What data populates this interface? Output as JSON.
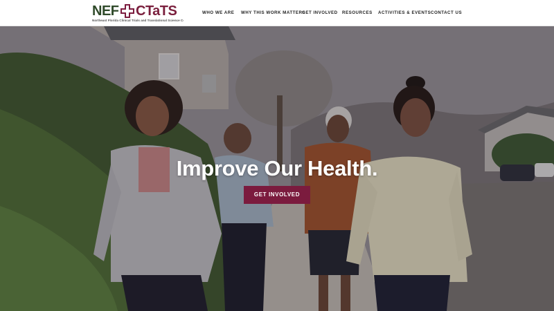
{
  "brand": {
    "logo_left": "NEF",
    "logo_right": "CTaTS",
    "tagline": "Northeast Florida Clinical Trials and Translational Science Consortium",
    "primary_color": "#7b1b3e",
    "secondary_color": "#2f4a2a"
  },
  "nav": {
    "items": [
      {
        "label": "WHO WE ARE"
      },
      {
        "label": "WHY THIS WORK MATTERS"
      },
      {
        "label": "GET INVOLVED"
      },
      {
        "label": "RESOURCES"
      },
      {
        "label": "ACTIVITIES & EVENTS"
      },
      {
        "label": "CONTACT US"
      }
    ]
  },
  "hero": {
    "title": "Improve Our Health.",
    "cta_label": "GET INVOLVED",
    "image_description_icon": "people-walking-photo"
  }
}
